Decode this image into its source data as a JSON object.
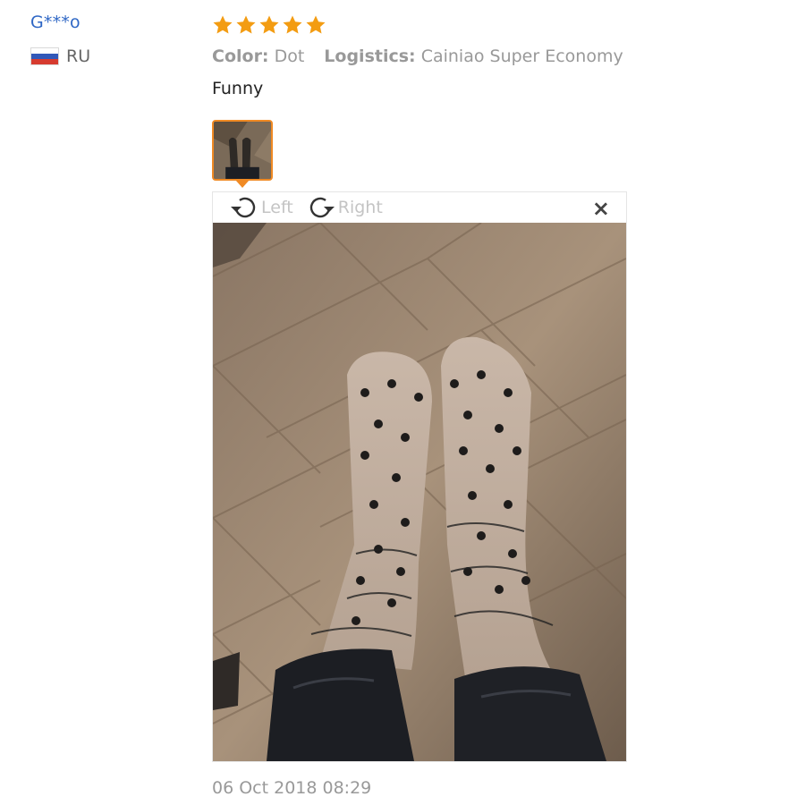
{
  "user": {
    "name": "G***o",
    "country_code": "RU",
    "flag": "russia-flag"
  },
  "review": {
    "rating": 5,
    "rating_color": "#f39c12",
    "color_label": "Color:",
    "color_value": "Dot",
    "logistics_label": "Logistics:",
    "logistics_value": "Cainiao Super Economy",
    "text": "Funny",
    "date": "06 Oct 2018 08:29"
  },
  "viewer": {
    "rotate_left_label": "Left",
    "rotate_right_label": "Right",
    "close_glyph": "×",
    "rotate_left_icon": "rotate-left-icon",
    "rotate_right_icon": "rotate-right-icon",
    "close_icon": "close-icon"
  },
  "colors": {
    "username": "#2f67c5",
    "thumbnail_border": "#f08a24"
  }
}
